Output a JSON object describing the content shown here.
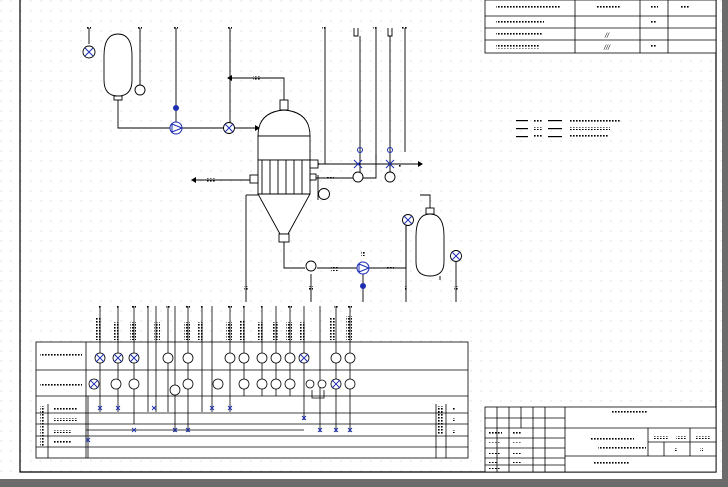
{
  "window": {
    "frame_color": "#6b6b6b",
    "canvas_color": "#ffffff",
    "grid_color": "#b9b9b9",
    "ink_color": "#000000",
    "symbol_accent": "#1c2db0"
  },
  "drawing": {
    "title_block_table": {
      "rows": [
        {
          "mark": "",
          "value": ""
        },
        {
          "mark": "",
          "value": ""
        },
        {
          "mark": "//",
          "value": ""
        },
        {
          "mark": "///",
          "value": ""
        }
      ]
    },
    "center_markers": {
      "vessel_left": "",
      "column": "",
      "vessel_right": ""
    },
    "bottom_table": {
      "short_label": ""
    }
  },
  "icons": {
    "instrument": "instrument-bubble-icon",
    "valve": "gate-valve-icon",
    "pump": "pump-icon",
    "flow_arrow": "flow-arrow-icon"
  }
}
